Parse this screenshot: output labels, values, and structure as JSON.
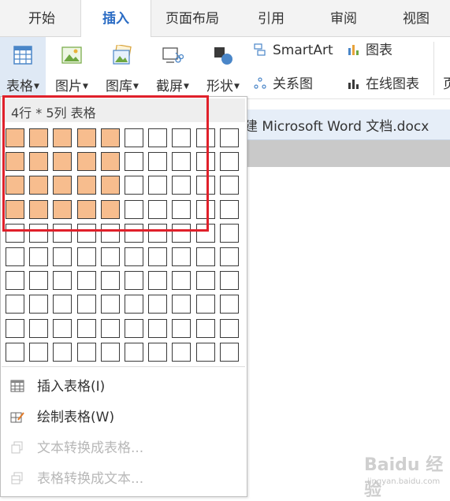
{
  "tabs": [
    "开始",
    "插入",
    "页面布局",
    "引用",
    "审阅",
    "视图"
  ],
  "active_tab": "插入",
  "ribbon": {
    "table_label": "表格",
    "picture_label": "图片",
    "gallery_label": "图库",
    "screenshot_label": "截屏",
    "shapes_label": "形状",
    "smartart_label": "SmartArt",
    "chart_label": "图表",
    "relation_label": "关系图",
    "online_chart_label": "在线图表",
    "cut_label": "页"
  },
  "document": {
    "title": "建 Microsoft Word 文档.docx"
  },
  "table_dropdown": {
    "header": "4行 * 5列 表格",
    "grid_rows": 10,
    "grid_cols": 10,
    "selected_rows": 4,
    "selected_cols": 5,
    "menu": [
      {
        "label": "插入表格(I)",
        "icon": "table-grid-icon",
        "enabled": true
      },
      {
        "label": "绘制表格(W)",
        "icon": "pencil-table-icon",
        "enabled": true
      },
      {
        "label": "文本转换成表格...",
        "icon": "text-to-table-icon",
        "enabled": false
      },
      {
        "label": "表格转换成文本...",
        "icon": "table-to-text-icon",
        "enabled": false
      }
    ]
  },
  "colors": {
    "accent": "#2b6cc4",
    "selected_cell": "#f7bd8e",
    "highlight_border": "#e0202a"
  },
  "watermark": {
    "main": "Baidu 经验",
    "sub": "jingyan.baidu.com"
  }
}
